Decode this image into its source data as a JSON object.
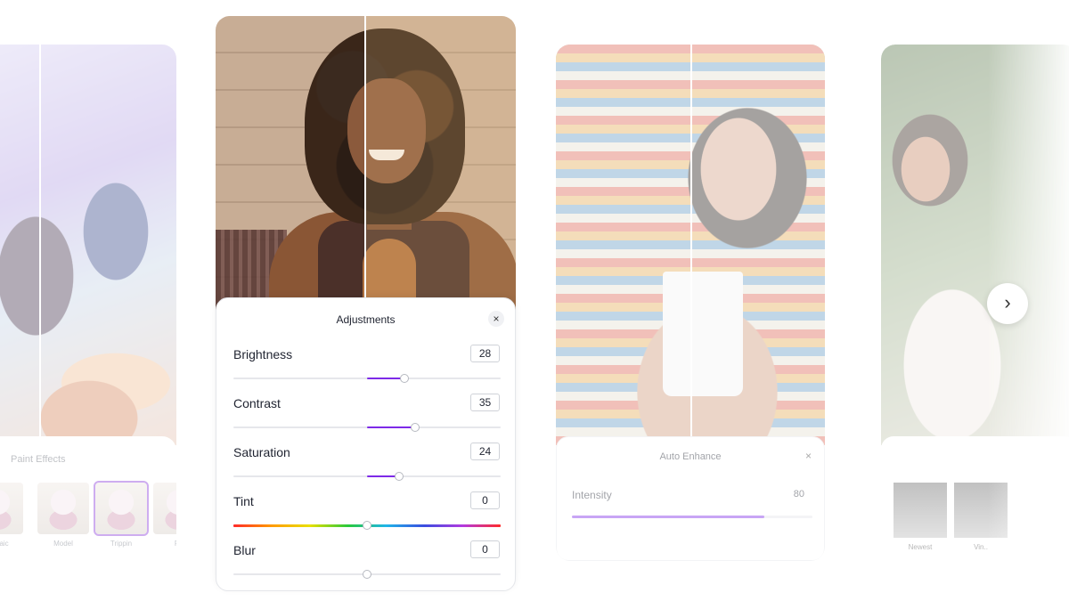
{
  "paint_effects": {
    "title": "Paint Effects",
    "thumbnails": [
      {
        "label": "Mosaic",
        "selected": false
      },
      {
        "label": "Model",
        "selected": false
      },
      {
        "label": "Trippin",
        "selected": true
      },
      {
        "label": "R..",
        "selected": false
      }
    ]
  },
  "adjustments": {
    "title": "Adjustments",
    "close_icon": "×",
    "rows": [
      {
        "label": "Brightness",
        "value": "28",
        "fraction": 0.64
      },
      {
        "label": "Contrast",
        "value": "35",
        "fraction": 0.68
      },
      {
        "label": "Saturation",
        "value": "24",
        "fraction": 0.62
      },
      {
        "label": "Tint",
        "value": "0",
        "fraction": 0.5
      },
      {
        "label": "Blur",
        "value": "0",
        "fraction": 0.5
      }
    ]
  },
  "auto_enhance": {
    "title": "Auto Enhance",
    "close_icon": "×",
    "label": "Intensity",
    "value": "80",
    "fraction": 0.8
  },
  "filters": {
    "thumbnails": [
      {
        "label": "Newest"
      },
      {
        "label": "Vin.."
      }
    ]
  },
  "next_icon": "›",
  "colors": {
    "accent": "#7d2ae8"
  }
}
